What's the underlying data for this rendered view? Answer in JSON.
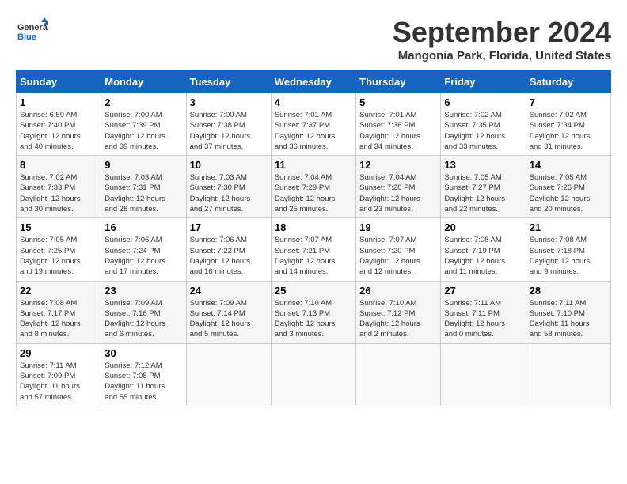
{
  "header": {
    "logo": {
      "general": "General",
      "blue": "Blue"
    },
    "title": "September 2024",
    "location": "Mangonia Park, Florida, United States"
  },
  "calendar": {
    "weekdays": [
      "Sunday",
      "Monday",
      "Tuesday",
      "Wednesday",
      "Thursday",
      "Friday",
      "Saturday"
    ],
    "weeks": [
      [
        {
          "day": "1",
          "info": "Sunrise: 6:59 AM\nSunset: 7:40 PM\nDaylight: 12 hours\nand 40 minutes."
        },
        {
          "day": "2",
          "info": "Sunrise: 7:00 AM\nSunset: 7:39 PM\nDaylight: 12 hours\nand 39 minutes."
        },
        {
          "day": "3",
          "info": "Sunrise: 7:00 AM\nSunset: 7:38 PM\nDaylight: 12 hours\nand 37 minutes."
        },
        {
          "day": "4",
          "info": "Sunrise: 7:01 AM\nSunset: 7:37 PM\nDaylight: 12 hours\nand 36 minutes."
        },
        {
          "day": "5",
          "info": "Sunrise: 7:01 AM\nSunset: 7:36 PM\nDaylight: 12 hours\nand 34 minutes."
        },
        {
          "day": "6",
          "info": "Sunrise: 7:02 AM\nSunset: 7:35 PM\nDaylight: 12 hours\nand 33 minutes."
        },
        {
          "day": "7",
          "info": "Sunrise: 7:02 AM\nSunset: 7:34 PM\nDaylight: 12 hours\nand 31 minutes."
        }
      ],
      [
        {
          "day": "8",
          "info": "Sunrise: 7:02 AM\nSunset: 7:33 PM\nDaylight: 12 hours\nand 30 minutes."
        },
        {
          "day": "9",
          "info": "Sunrise: 7:03 AM\nSunset: 7:31 PM\nDaylight: 12 hours\nand 28 minutes."
        },
        {
          "day": "10",
          "info": "Sunrise: 7:03 AM\nSunset: 7:30 PM\nDaylight: 12 hours\nand 27 minutes."
        },
        {
          "day": "11",
          "info": "Sunrise: 7:04 AM\nSunset: 7:29 PM\nDaylight: 12 hours\nand 25 minutes."
        },
        {
          "day": "12",
          "info": "Sunrise: 7:04 AM\nSunset: 7:28 PM\nDaylight: 12 hours\nand 23 minutes."
        },
        {
          "day": "13",
          "info": "Sunrise: 7:05 AM\nSunset: 7:27 PM\nDaylight: 12 hours\nand 22 minutes."
        },
        {
          "day": "14",
          "info": "Sunrise: 7:05 AM\nSunset: 7:26 PM\nDaylight: 12 hours\nand 20 minutes."
        }
      ],
      [
        {
          "day": "15",
          "info": "Sunrise: 7:05 AM\nSunset: 7:25 PM\nDaylight: 12 hours\nand 19 minutes."
        },
        {
          "day": "16",
          "info": "Sunrise: 7:06 AM\nSunset: 7:24 PM\nDaylight: 12 hours\nand 17 minutes."
        },
        {
          "day": "17",
          "info": "Sunrise: 7:06 AM\nSunset: 7:22 PM\nDaylight: 12 hours\nand 16 minutes."
        },
        {
          "day": "18",
          "info": "Sunrise: 7:07 AM\nSunset: 7:21 PM\nDaylight: 12 hours\nand 14 minutes."
        },
        {
          "day": "19",
          "info": "Sunrise: 7:07 AM\nSunset: 7:20 PM\nDaylight: 12 hours\nand 12 minutes."
        },
        {
          "day": "20",
          "info": "Sunrise: 7:08 AM\nSunset: 7:19 PM\nDaylight: 12 hours\nand 11 minutes."
        },
        {
          "day": "21",
          "info": "Sunrise: 7:08 AM\nSunset: 7:18 PM\nDaylight: 12 hours\nand 9 minutes."
        }
      ],
      [
        {
          "day": "22",
          "info": "Sunrise: 7:08 AM\nSunset: 7:17 PM\nDaylight: 12 hours\nand 8 minutes."
        },
        {
          "day": "23",
          "info": "Sunrise: 7:09 AM\nSunset: 7:16 PM\nDaylight: 12 hours\nand 6 minutes."
        },
        {
          "day": "24",
          "info": "Sunrise: 7:09 AM\nSunset: 7:14 PM\nDaylight: 12 hours\nand 5 minutes."
        },
        {
          "day": "25",
          "info": "Sunrise: 7:10 AM\nSunset: 7:13 PM\nDaylight: 12 hours\nand 3 minutes."
        },
        {
          "day": "26",
          "info": "Sunrise: 7:10 AM\nSunset: 7:12 PM\nDaylight: 12 hours\nand 2 minutes."
        },
        {
          "day": "27",
          "info": "Sunrise: 7:11 AM\nSunset: 7:11 PM\nDaylight: 12 hours\nand 0 minutes."
        },
        {
          "day": "28",
          "info": "Sunrise: 7:11 AM\nSunset: 7:10 PM\nDaylight: 11 hours\nand 58 minutes."
        }
      ],
      [
        {
          "day": "29",
          "info": "Sunrise: 7:11 AM\nSunset: 7:09 PM\nDaylight: 11 hours\nand 57 minutes."
        },
        {
          "day": "30",
          "info": "Sunrise: 7:12 AM\nSunset: 7:08 PM\nDaylight: 11 hours\nand 55 minutes."
        },
        {
          "day": "",
          "info": ""
        },
        {
          "day": "",
          "info": ""
        },
        {
          "day": "",
          "info": ""
        },
        {
          "day": "",
          "info": ""
        },
        {
          "day": "",
          "info": ""
        }
      ]
    ]
  }
}
